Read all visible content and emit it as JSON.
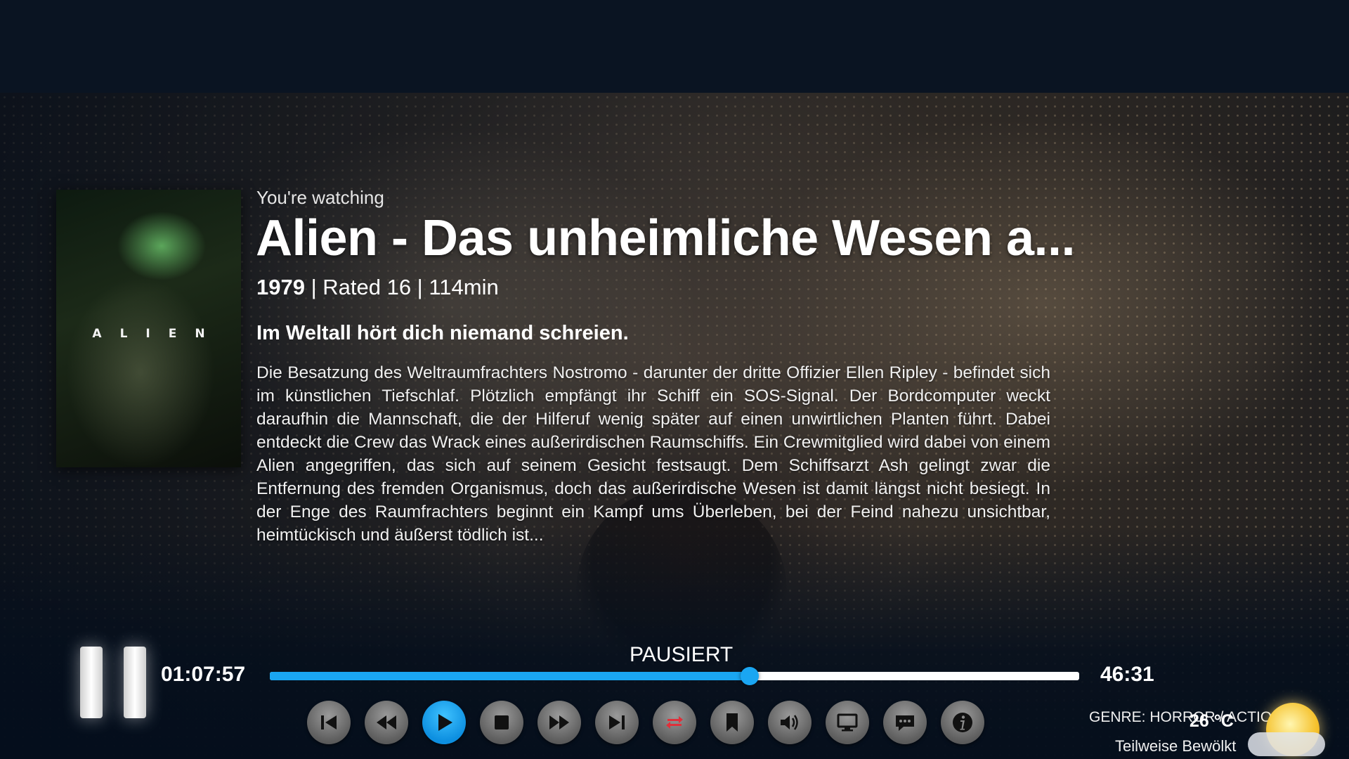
{
  "header": {
    "label": "You're watching",
    "title": "Alien - Das unheimliche Wesen a...",
    "year": "1979",
    "meta_rest": " | Rated 16 | 114min",
    "tagline": "Im Weltall hört dich niemand schreien.",
    "plot": "Die Besatzung des Weltraumfrachters Nostromo - darunter der dritte Offizier Ellen Ripley - befindet sich im künstlichen Tiefschlaf. Plötzlich empfängt ihr Schiff ein SOS-Signal. Der Bordcomputer weckt daraufhin die Mannschaft, die der Hilferuf wenig später auf einen unwirtlichen Planten führt. Dabei entdeckt die Crew das Wrack eines außerirdischen Raumschiffs. Ein Crewmitglied wird dabei von einem Alien angegriffen, das sich auf seinem Gesicht festsaugt. Dem Schiffsarzt Ash gelingt zwar die Entfernung des fremden Organismus, doch das außerirdische Wesen ist damit längst nicht besiegt. In der Enge des Raumfrachters beginnt ein Kampf ums Überleben, bei der Feind nahezu unsichtbar, heimtückisch und äußerst tödlich ist..."
  },
  "poster": {
    "title": "ALIEN"
  },
  "player": {
    "state": "PAUSIERT",
    "elapsed": "01:07:57",
    "remaining": "46:31",
    "progress_fraction": 0.593,
    "accent": "#1aa6f2"
  },
  "controls": [
    {
      "name": "skip-previous",
      "icon": "skip-previous-icon",
      "active": false
    },
    {
      "name": "rewind",
      "icon": "rewind-icon",
      "active": false
    },
    {
      "name": "play",
      "icon": "play-icon",
      "active": true
    },
    {
      "name": "stop",
      "icon": "stop-icon",
      "active": false
    },
    {
      "name": "fast-forward",
      "icon": "fast-forward-icon",
      "active": false
    },
    {
      "name": "skip-next",
      "icon": "skip-next-icon",
      "active": false
    },
    {
      "name": "repeat",
      "icon": "repeat-icon",
      "active": false,
      "color": "#e0303a"
    },
    {
      "name": "bookmark",
      "icon": "bookmark-icon",
      "active": false
    },
    {
      "name": "volume",
      "icon": "volume-icon",
      "active": false
    },
    {
      "name": "display-settings",
      "icon": "monitor-icon",
      "active": false
    },
    {
      "name": "subtitles",
      "icon": "subtitles-icon",
      "active": false
    },
    {
      "name": "info",
      "icon": "info-icon",
      "active": false
    }
  ],
  "footer": {
    "genre": "GENRE: HORROR / ACTION",
    "temperature": "26 °C",
    "weather": "Teilweise Bewölkt"
  }
}
